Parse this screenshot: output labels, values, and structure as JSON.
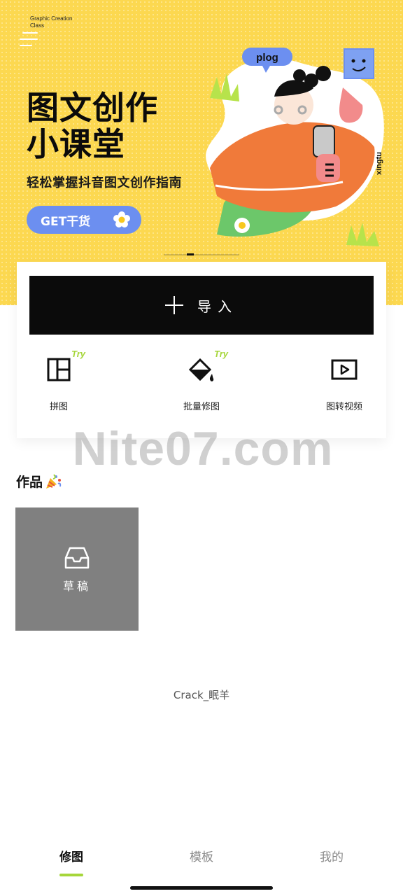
{
  "banner": {
    "brand_line1": "Graphic Creation",
    "brand_line2": "Class",
    "title_line1": "图文创作",
    "title_line2": "小课堂",
    "subtitle": "轻松掌握抖音图文创作指南",
    "cta": "GET干货",
    "bubble": "plog",
    "side_text": "xingtu",
    "colors": {
      "background": "#fcd850",
      "pill": "#6c8ff0",
      "accent_orange": "#f07a3a",
      "accent_green": "#6cc76a"
    }
  },
  "actions": {
    "import_label": "导入",
    "tools": [
      {
        "label": "拼图",
        "badge": "Try",
        "icon": "collage-grid-icon"
      },
      {
        "label": "批量修图",
        "badge": "Try",
        "icon": "paint-bucket-icon"
      },
      {
        "label": "图转视频",
        "badge": "",
        "icon": "play-video-icon"
      }
    ]
  },
  "watermark": "Nite07.com",
  "works": {
    "title": "作品",
    "draft_label": "草稿"
  },
  "credit": "Crack_眠羊",
  "tabs": [
    {
      "label": "修图",
      "active": true
    },
    {
      "label": "模板",
      "active": false
    },
    {
      "label": "我的",
      "active": false
    }
  ],
  "accent": "#a6d63a"
}
